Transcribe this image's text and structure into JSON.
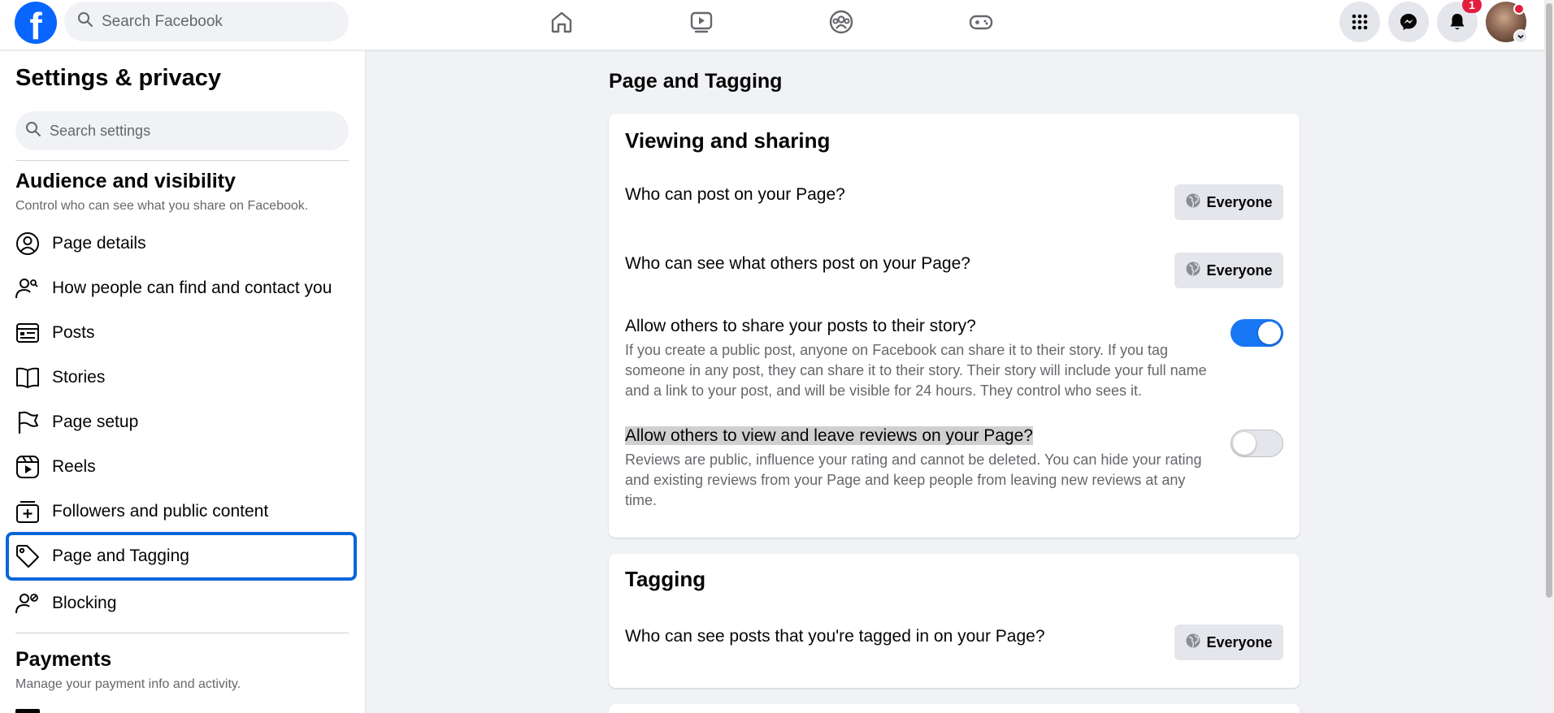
{
  "topbar": {
    "logo": "f",
    "search_placeholder": "Search Facebook",
    "nav_icons": [
      "home-icon",
      "watch-icon",
      "groups-icon",
      "gaming-icon"
    ],
    "right_icons": [
      "menu-grid-icon",
      "messenger-icon",
      "notifications-icon"
    ],
    "notification_count": "1"
  },
  "sidebar": {
    "title": "Settings & privacy",
    "search_placeholder": "Search settings",
    "section1": {
      "title": "Audience and visibility",
      "subtitle": "Control who can see what you share on Facebook."
    },
    "items": [
      {
        "label": "Page details",
        "icon": "person-circle-icon"
      },
      {
        "label": "How people can find and contact you",
        "icon": "person-search-icon"
      },
      {
        "label": "Posts",
        "icon": "posts-icon"
      },
      {
        "label": "Stories",
        "icon": "book-icon"
      },
      {
        "label": "Page setup",
        "icon": "flag-icon"
      },
      {
        "label": "Reels",
        "icon": "reels-icon"
      },
      {
        "label": "Followers and public content",
        "icon": "followers-icon"
      },
      {
        "label": "Page and Tagging",
        "icon": "tag-icon",
        "active": true
      },
      {
        "label": "Blocking",
        "icon": "blocking-icon"
      }
    ],
    "section2": {
      "title": "Payments",
      "subtitle": "Manage your payment info and activity."
    }
  },
  "main": {
    "title": "Page and Tagging",
    "viewing_card": {
      "heading": "Viewing and sharing",
      "q1": "Who can post on your Page?",
      "q1_value": "Everyone",
      "q2": "Who can see what others post on your Page?",
      "q2_value": "Everyone",
      "q3": "Allow others to share your posts to their story?",
      "q3_desc": "If you create a public post, anyone on Facebook can share it to their story. If you tag someone in any post, they can share it to their story. Their story will include your full name and a link to your post, and will be visible for 24 hours. They control who sees it.",
      "q3_enabled": true,
      "q4": "Allow others to view and leave reviews on your Page?",
      "q4_desc": "Reviews are public, influence your rating and cannot be deleted. You can hide your rating and existing reviews from your Page and keep people from leaving new reviews at any time.",
      "q4_enabled": false
    },
    "tagging_card": {
      "heading": "Tagging",
      "q1": "Who can see posts that you're tagged in on your Page?",
      "q1_value": "Everyone"
    }
  },
  "colors": {
    "accent": "#1877f2",
    "logo": "#0866ff",
    "badge": "#e41e3f",
    "active_border": "#0a66d8"
  }
}
